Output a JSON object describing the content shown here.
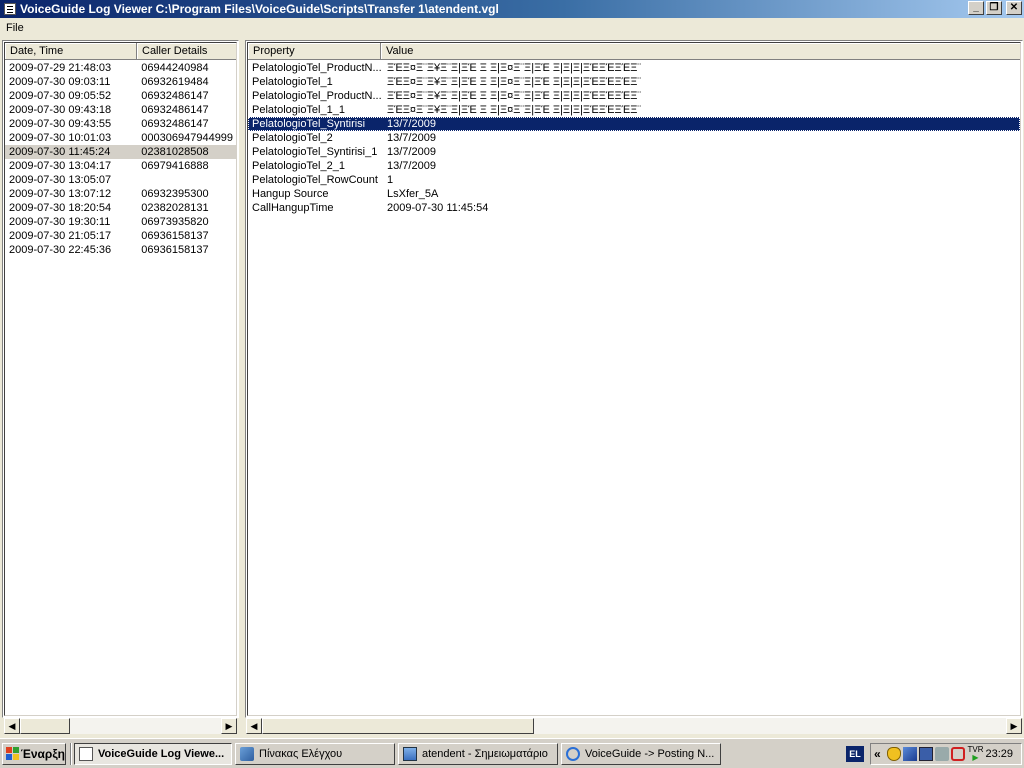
{
  "window": {
    "title": "VoiceGuide Log Viewer C:\\Program Files\\VoiceGuide\\Scripts\\Transfer 1\\atendent.vgl",
    "minimize": "_",
    "restore": "❐",
    "close": "✕"
  },
  "menu": {
    "file": "File"
  },
  "left_list": {
    "columns": [
      "Date, Time",
      "Caller Details"
    ],
    "rows": [
      [
        "2009-07-29 21:48:03",
        "06944240984"
      ],
      [
        "2009-07-30 09:03:11",
        "06932619484"
      ],
      [
        "2009-07-30 09:05:52",
        "06932486147"
      ],
      [
        "2009-07-30 09:43:18",
        "06932486147"
      ],
      [
        "2009-07-30 09:43:55",
        "06932486147"
      ],
      [
        "2009-07-30 10:01:03",
        "000306947944999"
      ],
      [
        "2009-07-30 11:45:24",
        "02381028508"
      ],
      [
        "2009-07-30 13:04:17",
        "06979416888"
      ],
      [
        "2009-07-30 13:05:07",
        ""
      ],
      [
        "2009-07-30 13:07:12",
        "06932395300"
      ],
      [
        "2009-07-30 18:20:54",
        "02382028131"
      ],
      [
        "2009-07-30 19:30:11",
        "06973935820"
      ],
      [
        "2009-07-30 21:05:17",
        "06936158137"
      ],
      [
        "2009-07-30 22:45:36",
        "06936158137"
      ]
    ],
    "selected_index": 6
  },
  "right_list": {
    "columns": [
      "Property",
      "Value"
    ],
    "rows": [
      [
        "PelatologioTel_ProductN...",
        "ΞΈΞ¤Ξ¨Ξ¥Ξ¨Ξ|ΞΈ Ξ Ξ|Ξ¤Ξ¨Ξ|ΞΈ Ξ|Ξ|Ξ|ΞΈΞΈΞΈΞ¨"
      ],
      [
        "PelatologioTel_1",
        "ΞΈΞ¤Ξ¨Ξ¥Ξ¨Ξ|ΞΈ Ξ Ξ|Ξ¤Ξ¨Ξ|ΞΈ Ξ|Ξ|Ξ|ΞΈΞΈΞΈΞ¨"
      ],
      [
        "PelatologioTel_ProductN...",
        "ΞΈΞ¤Ξ¨Ξ¥Ξ¨Ξ|ΞΈ Ξ Ξ|Ξ¤Ξ¨Ξ|ΞΈ Ξ|Ξ|Ξ|ΞΈΞΈΞΈΞ¨"
      ],
      [
        "PelatologioTel_1_1",
        "ΞΈΞ¤Ξ¨Ξ¥Ξ¨Ξ|ΞΈ Ξ Ξ|Ξ¤Ξ¨Ξ|ΞΈ Ξ|Ξ|Ξ|ΞΈΞΈΞΈΞ¨"
      ],
      [
        "PelatologioTel_Syntirisi",
        "13/7/2009"
      ],
      [
        "PelatologioTel_2",
        "13/7/2009"
      ],
      [
        "PelatologioTel_Syntirisi_1",
        "13/7/2009"
      ],
      [
        "PelatologioTel_2_1",
        "13/7/2009"
      ],
      [
        "PelatologioTel_RowCount",
        "1"
      ],
      [
        "Hangup Source",
        "LsXfer_5A"
      ],
      [
        "CallHangupTime",
        "2009-07-30 11:45:54"
      ]
    ],
    "selected_index": 4
  },
  "scrollbars": {
    "left_arrow": "◀",
    "right_arrow": "▶"
  },
  "taskbar": {
    "start": "Έναρξη",
    "buttons": [
      "VoiceGuide Log Viewe...",
      "Πίνακας Ελέγχου",
      "atendent - Σημειωματάριο",
      "VoiceGuide -> Posting N..."
    ],
    "active_index": 0,
    "language": "EL",
    "tray_chevron": "«",
    "tray_tvr": "TVR",
    "clock": "23:29"
  }
}
